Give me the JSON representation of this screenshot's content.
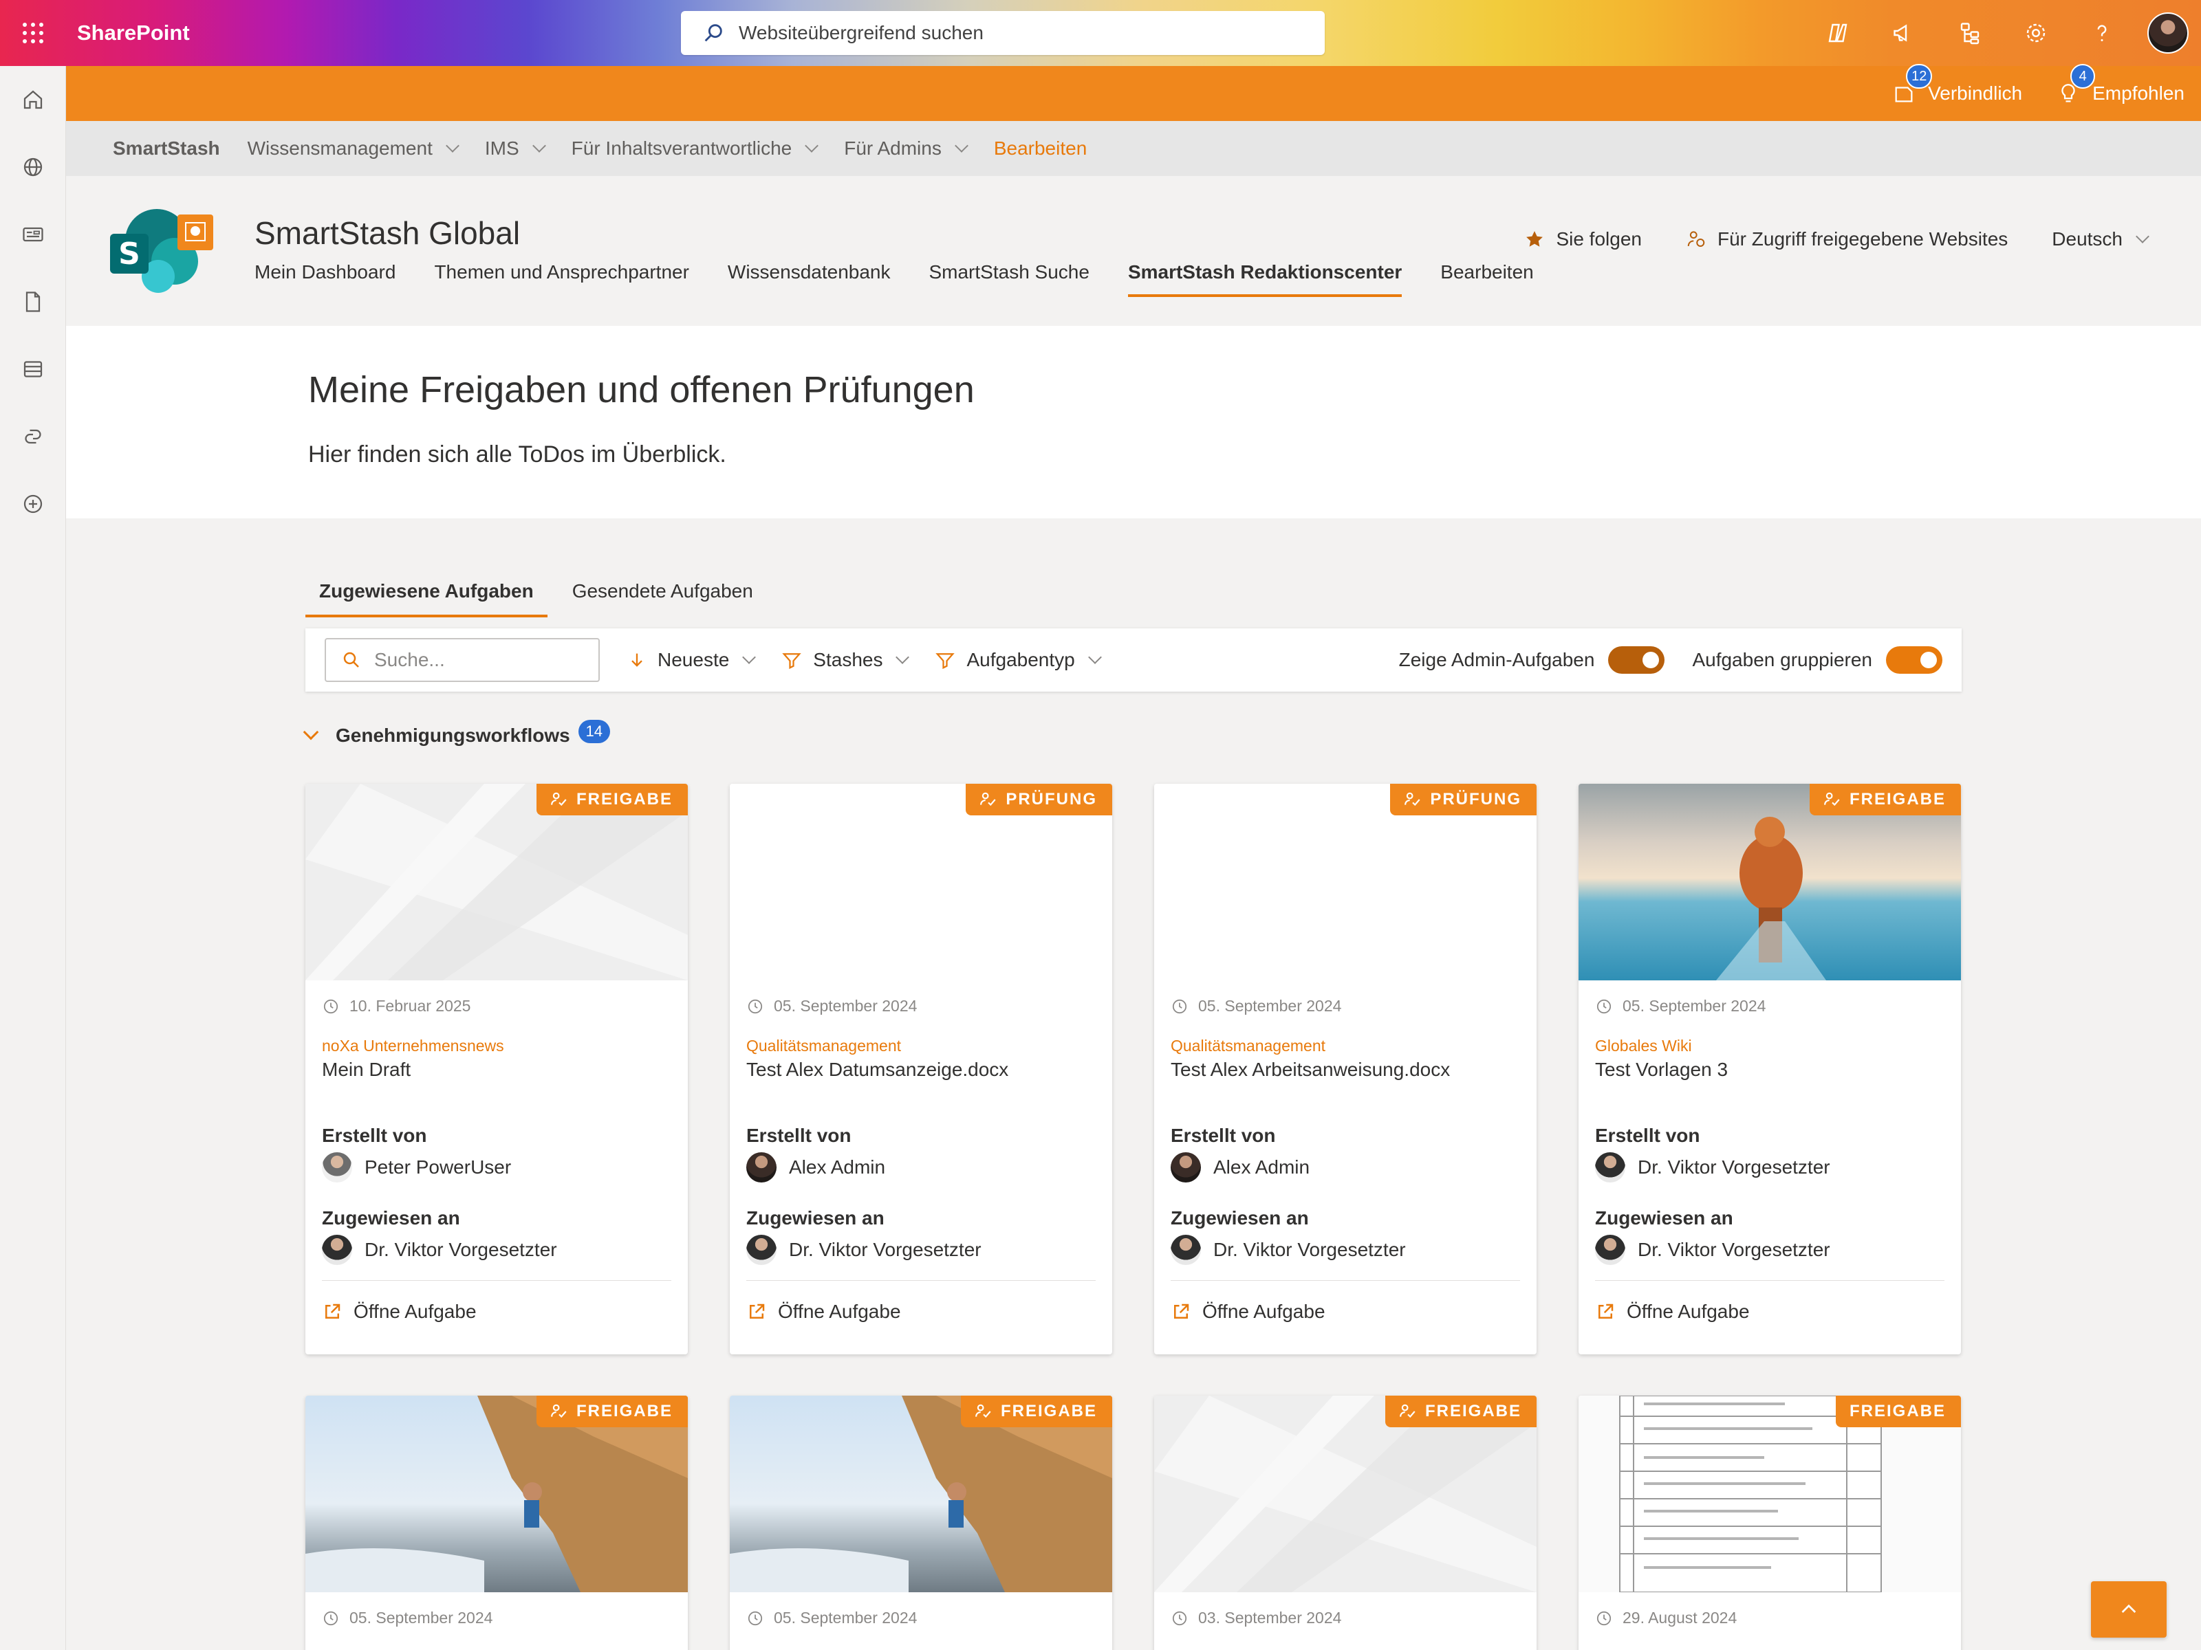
{
  "suite": {
    "brand": "SharePoint",
    "search_placeholder": "Websiteübergreifend suchen"
  },
  "orangebar": {
    "items": [
      {
        "label": "Verbindlich",
        "badge": "12"
      },
      {
        "label": "Empfohlen",
        "badge": "4"
      }
    ]
  },
  "hubnav": {
    "items": [
      "SmartStash",
      "Wissensmanagement",
      "IMS",
      "Für Inhaltsverantwortliche",
      "Für Admins",
      "Bearbeiten"
    ]
  },
  "site": {
    "title": "SmartStash Global",
    "nav": [
      "Mein Dashboard",
      "Themen und Ansprechpartner",
      "Wissensdatenbank",
      "SmartStash Suche",
      "SmartStash Redaktionscenter",
      "Bearbeiten"
    ],
    "follow": "Sie folgen",
    "shared": "Für Zugriff freigegebene Websites",
    "language": "Deutsch"
  },
  "hero": {
    "title": "Meine Freigaben und offenen Prüfungen",
    "subtitle": "Hier finden sich alle ToDos im Überblick."
  },
  "tabs": [
    "Zugewiesene Aufgaben",
    "Gesendete Aufgaben"
  ],
  "toolbar": {
    "search_placeholder": "Suche...",
    "sort": "Neueste",
    "filter_stashes": "Stashes",
    "filter_type": "Aufgabentyp",
    "toggle_admin": "Zeige Admin-Aufgaben",
    "toggle_group": "Aufgaben gruppieren"
  },
  "group": {
    "label": "Genehmigungsworkflows",
    "count": "14"
  },
  "labels": {
    "created_by": "Erstellt von",
    "assigned_to": "Zugewiesen an",
    "open_task": "Öffne Aufgabe"
  },
  "cards": [
    {
      "badge": "FREIGABE",
      "date": "10. Februar 2025",
      "category": "noXa Unternehmensnews",
      "title": "Mein Draft",
      "creator": "Peter PowerUser",
      "assignee": "Dr. Viktor Vorgesetzter"
    },
    {
      "badge": "PRÜFUNG",
      "date": "05. September 2024",
      "category": "Qualitätsmanagement",
      "title": "Test Alex Datumsanzeige.docx",
      "creator": "Alex Admin",
      "assignee": "Dr. Viktor Vorgesetzter"
    },
    {
      "badge": "PRÜFUNG",
      "date": "05. September 2024",
      "category": "Qualitätsmanagement",
      "title": "Test Alex Arbeitsanweisung.docx",
      "creator": "Alex Admin",
      "assignee": "Dr. Viktor Vorgesetzter"
    },
    {
      "badge": "FREIGABE",
      "date": "05. September 2024",
      "category": "Globales Wiki",
      "title": "Test Vorlagen 3",
      "creator": "Dr. Viktor Vorgesetzter",
      "assignee": "Dr. Viktor Vorgesetzter"
    },
    {
      "badge": "FREIGABE",
      "date": "05. September 2024"
    },
    {
      "badge": "FREIGABE",
      "date": "05. September 2024"
    },
    {
      "badge": "FREIGABE",
      "date": "03. September 2024"
    },
    {
      "badge": "FREIGABE",
      "date": "29. August 2024"
    }
  ],
  "colors": {
    "accent": "#f0871c",
    "accent_text": "#e87a0c",
    "badge_blue": "#2b6fd6"
  }
}
